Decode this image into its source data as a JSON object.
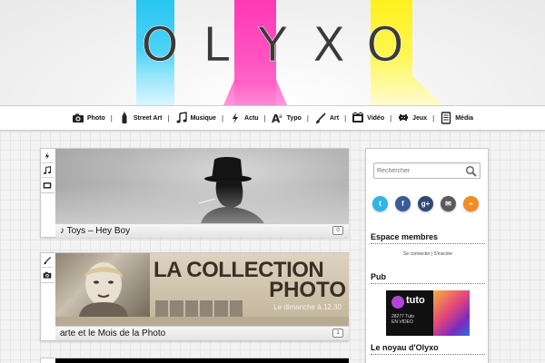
{
  "logo": {
    "letters": [
      "O",
      "L",
      "Y",
      "X",
      "O"
    ]
  },
  "nav": {
    "items": [
      {
        "label": "Photo",
        "icon": "camera-icon"
      },
      {
        "label": "Street Art",
        "icon": "spray-can-icon"
      },
      {
        "label": "Musique",
        "icon": "music-note-icon"
      },
      {
        "label": "Actu",
        "icon": "lightning-icon"
      },
      {
        "label": "Typo",
        "icon": "typography-icon"
      },
      {
        "label": "Art",
        "icon": "brush-icon"
      },
      {
        "label": "Vidéo",
        "icon": "film-icon"
      },
      {
        "label": "Jeux",
        "icon": "space-invader-icon"
      },
      {
        "label": "Média",
        "icon": "document-icon"
      }
    ],
    "separator": "|"
  },
  "posts": [
    {
      "caption": "♪ Toys – Hey Boy",
      "comments": "0",
      "categories": [
        "lightning-icon",
        "music-note-icon",
        "film-icon"
      ]
    },
    {
      "caption": "arte et le Mois de la Photo",
      "comments": "1",
      "categories": [
        "brush-icon",
        "camera-icon"
      ],
      "image_title_1": "LA COLLECTION",
      "image_title_2": "PHOTO",
      "image_sub": "Le dimanche à 12.30"
    }
  ],
  "sidebar": {
    "search_placeholder": "Rechercher",
    "social": [
      {
        "name": "twitter",
        "label": "t",
        "color": "#2fb5e8"
      },
      {
        "name": "facebook",
        "label": "f",
        "color": "#3b5a9a"
      },
      {
        "name": "google-plus",
        "label": "g+",
        "color": "#2f4a73"
      },
      {
        "name": "email",
        "label": "✉",
        "color": "#5b5b5b"
      },
      {
        "name": "rss",
        "label": "⌁",
        "color": "#f58a1f"
      }
    ],
    "members_heading": "Espace membres",
    "members_links": "Se connecter | S'inscrire",
    "pub_heading": "Pub",
    "tuto": {
      "word": "tuto",
      "line1": "28277 Tuto",
      "line2": "EN VIDEO"
    },
    "noyau_heading": "Le noyau d'Olyxo"
  }
}
